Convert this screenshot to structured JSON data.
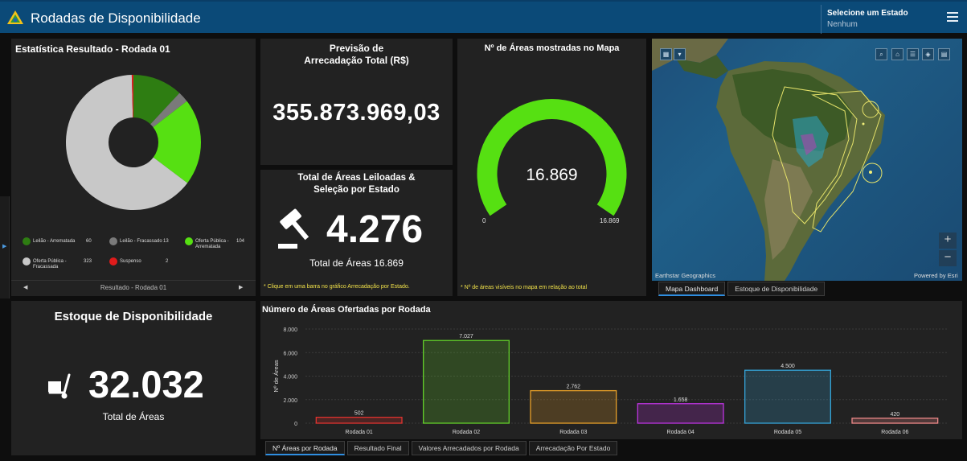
{
  "header": {
    "title": "Rodadas de Disponibilidade",
    "state_label": "Selecione um Estado",
    "state_value": "Nenhum"
  },
  "colors": {
    "header_bg": "#0b4a78",
    "panel_bg": "#222222",
    "accent_green": "#56e012",
    "note_yellow": "#f2e24a"
  },
  "donut_panel": {
    "title": "Estatística Resultado - Rodada 01",
    "nav_label": "Resultado - Rodada 01",
    "slices": [
      {
        "label": "Leilão - Arrematada",
        "value": 60,
        "color": "#2e7d12"
      },
      {
        "label": "Leilão - Fracassado",
        "value": 13,
        "color": "#7a7a7a"
      },
      {
        "label": "Oferta Pública - Arrematada",
        "value": 104,
        "color": "#56e012"
      },
      {
        "label": "Oferta Pública - Fracassada",
        "value": 323,
        "color": "#c8c8c8"
      },
      {
        "label": "Suspenso",
        "value": 2,
        "color": "#e01b1b"
      }
    ]
  },
  "revenue": {
    "title_line1": "Previsão de",
    "title_line2": "Arrecadação Total (R$)",
    "value": "355.873.969,03"
  },
  "areas_sold": {
    "title_line1": "Total de Áreas Leiloadas &",
    "title_line2": "Seleção por Estado",
    "value": "4.276",
    "subtitle": "Total de Áreas 16.869",
    "note": "* Clique em uma barra no gráfico Arrecadação por Estado.",
    "icon": "gavel-icon"
  },
  "gauge": {
    "title": "Nº de Áreas mostradas no Mapa",
    "value": 16869,
    "value_label": "16.869",
    "min_label": "0",
    "max_label": "16.869",
    "fill_fraction": 1.0,
    "note": "* Nº de áreas visíveis no mapa em relação ao total"
  },
  "map": {
    "credit_left": "Earthstar Geographics",
    "credit_right": "Powered by Esri",
    "zoom_in": "+",
    "zoom_out": "−",
    "tabs": [
      "Mapa Dashboard",
      "Estoque de Disponibilidade"
    ]
  },
  "stock": {
    "title": "Estoque de Disponibilidade",
    "value": "32.032",
    "subtitle": "Total de Áreas",
    "icon": "hand-truck-icon"
  },
  "bar_panel": {
    "tabs": [
      "Nº Áreas por Rodada",
      "Resultado Final",
      "Valores Arrecadados por Rodada",
      "Arrecadação Por Estado"
    ]
  },
  "chart_data": {
    "type": "bar",
    "title": "Número de Áreas Ofertadas por Rodada",
    "ylabel": "Nº de Áreas",
    "xlabel": "",
    "categories": [
      "Rodada 01",
      "Rodada 02",
      "Rodada 03",
      "Rodada 04",
      "Rodada 05",
      "Rodada 06"
    ],
    "values": [
      502,
      7027,
      2762,
      1658,
      4500,
      420
    ],
    "value_labels": [
      "502",
      "7.027",
      "2.762",
      "1.658",
      "4.500",
      "420"
    ],
    "colors": [
      "#e0332f",
      "#63d12a",
      "#e8a028",
      "#bd34e0",
      "#35a4d8",
      "#f08a8a"
    ],
    "ylim": [
      0,
      8000
    ],
    "yticks": [
      0,
      2000,
      4000,
      6000,
      8000
    ],
    "ytick_labels": [
      "0",
      "2.000",
      "4.000",
      "6.000",
      "8.000"
    ],
    "grid": true
  }
}
